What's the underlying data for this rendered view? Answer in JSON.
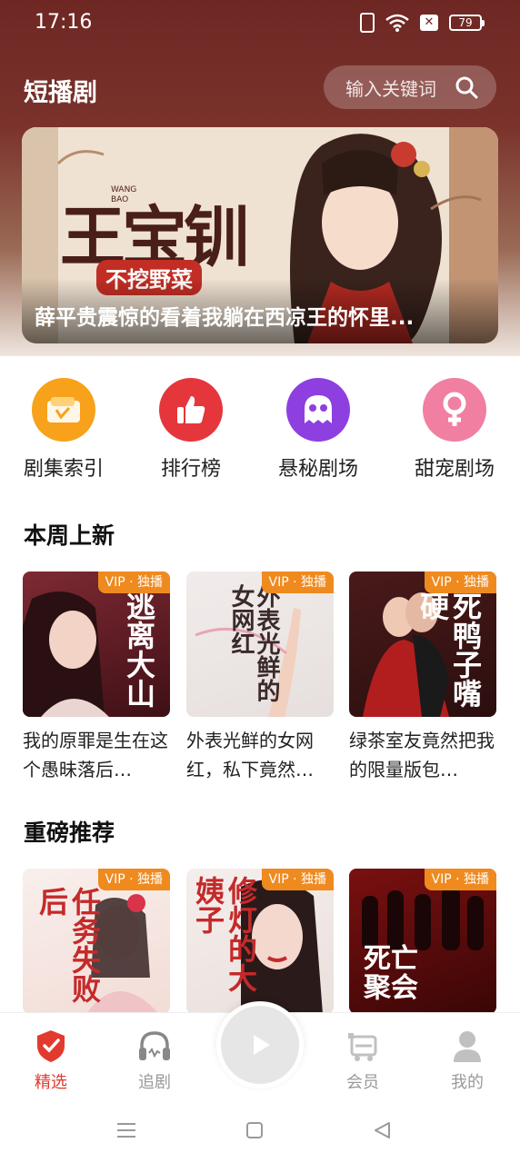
{
  "status_bar": {
    "time": "17:16",
    "battery": "79"
  },
  "header": {
    "title": "短播剧",
    "search_placeholder": "输入关键词"
  },
  "banner": {
    "cover_title": "王宝钏",
    "cover_subtitle": "不挖野菜",
    "cover_small": "WANG BAO",
    "caption": "薛平贵震惊的看着我躺在西凉王的怀里..."
  },
  "categories": [
    {
      "label": "剧集索引",
      "icon": "wallet-icon",
      "color": "#f7a21a"
    },
    {
      "label": "排行榜",
      "icon": "thumbs-up-icon",
      "color": "#e5363b"
    },
    {
      "label": "悬秘剧场",
      "icon": "ghost-icon",
      "color": "#8d3fe0"
    },
    {
      "label": "甜宠剧场",
      "icon": "female-symbol-icon",
      "color": "#f07fa2"
    }
  ],
  "sections": {
    "new_this_week": "本周上新",
    "recommended": "重磅推荐"
  },
  "new_cards": [
    {
      "badge": "VIP · 独播",
      "cover": "逃离大山",
      "title": "我的原罪是生在这个愚昧落后…"
    },
    {
      "badge": "VIP · 独播",
      "cover": "外表光鲜的女网红",
      "title": "外表光鲜的女网红，私下竟然…"
    },
    {
      "badge": "VIP · 独播",
      "cover": "死鸭子嘴硬",
      "title": "绿茶室友竟然把我的限量版包…"
    }
  ],
  "recommended_cards": [
    {
      "badge": "VIP · 独播",
      "cover": "任务失败后"
    },
    {
      "badge": "VIP · 独播",
      "cover": "修灯的大姨子"
    },
    {
      "badge": "VIP · 独播",
      "cover": "死亡聚会"
    }
  ],
  "bottom_nav": [
    {
      "label": "精选",
      "active": true
    },
    {
      "label": "追剧",
      "active": false
    },
    {
      "label": "会员",
      "active": false
    },
    {
      "label": "我的",
      "active": false
    }
  ],
  "colors": {
    "header": "#6e2723",
    "accent": "#e23a2f",
    "vip_badge": "#ef8a1f"
  }
}
